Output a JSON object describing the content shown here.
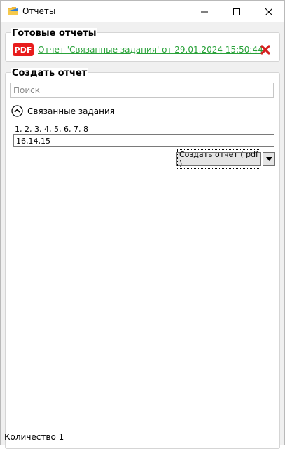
{
  "window": {
    "title": "Отчеты"
  },
  "ready_reports": {
    "title": "Готовые отчеты",
    "badge": "PDF",
    "items": [
      {
        "label": "Отчет 'Связанные задания' от 29.01.2024 15:50:44"
      }
    ]
  },
  "create_report": {
    "title": "Создать отчет",
    "search_placeholder": "Поиск",
    "section_title": "Связанные задания",
    "ids_hint": "1, 2, 3, 4, 5, 6, 7, 8",
    "ids_value": "16,14,15",
    "create_button_label": "Создать отчет ( pdf )"
  },
  "status": {
    "text": "Количество 1"
  },
  "colors": {
    "link": "#2aa23a",
    "pdf_badge": "#e81c1c",
    "delete": "#d61f1f"
  },
  "icons": [
    "app-folder-icon",
    "minimize-icon",
    "maximize-icon",
    "close-icon",
    "pdf-icon",
    "delete-icon",
    "chevron-up-icon",
    "chevron-down-icon"
  ]
}
